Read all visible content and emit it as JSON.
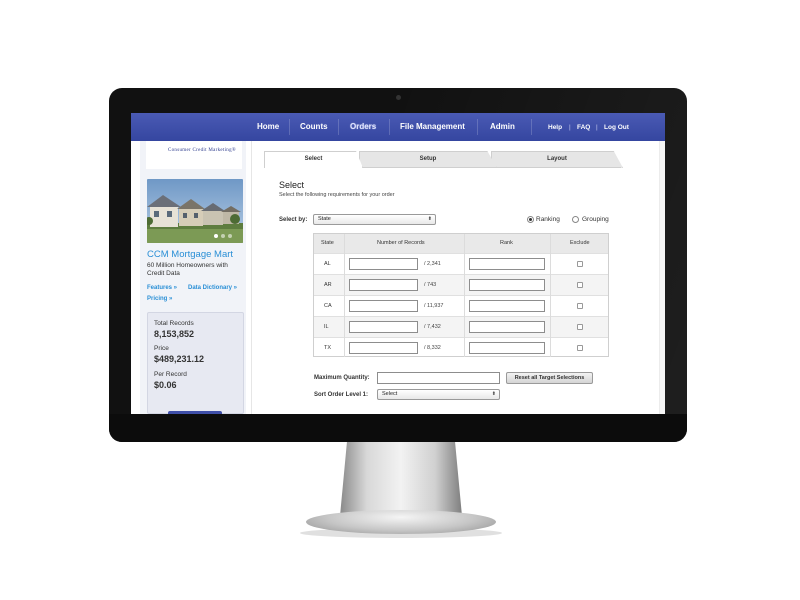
{
  "nav": {
    "home": "Home",
    "counts": "Counts",
    "orders": "Orders",
    "file_management": "File Management",
    "admin": "Admin",
    "help": "Help",
    "faq": "FAQ",
    "logout": "Log Out",
    "sep": "|"
  },
  "brand": {
    "logo_text": "Consumer Credit Marketing®",
    "accent_color": "#3f4fa8",
    "link_color": "#2a8fd6"
  },
  "sidebar": {
    "mart_title": "CCM Mortgage Mart",
    "mart_desc": "60 Million Homeowners with Credit Data",
    "links": {
      "features": "Features »",
      "data_dictionary": "Data Dictionary »",
      "pricing": "Pricing »"
    },
    "stats": {
      "total_label": "Total Records",
      "total_value": "8,153,852",
      "price_label": "Price",
      "price_value": "$489,231.12",
      "per_record_label": "Per Record",
      "per_record_value": "$0.06"
    }
  },
  "tabs": {
    "select": "Select",
    "setup": "Setup",
    "layout": "Layout"
  },
  "main": {
    "title": "Select",
    "subtitle": "Select the following requirements for your order",
    "select_by_label": "Select by:",
    "select_by_value": "State",
    "ranking_label": "Ranking",
    "grouping_label": "Grouping",
    "ranking_checked": true,
    "table": {
      "headers": {
        "state": "State",
        "records": "Number of Records",
        "rank": "Rank",
        "exclude": "Exclude"
      },
      "rows": [
        {
          "state": "AL",
          "count": "/ 2,341"
        },
        {
          "state": "AR",
          "count": "/ 743"
        },
        {
          "state": "CA",
          "count": "/ 11,937"
        },
        {
          "state": "IL",
          "count": "/ 7,432"
        },
        {
          "state": "TX",
          "count": "/ 8,332"
        }
      ]
    },
    "max_qty_label": "Maximum Quantity:",
    "reset_label": "Reset all Target Selections",
    "sort_label": "Sort Order Level 1:",
    "sort_value": "Select"
  }
}
